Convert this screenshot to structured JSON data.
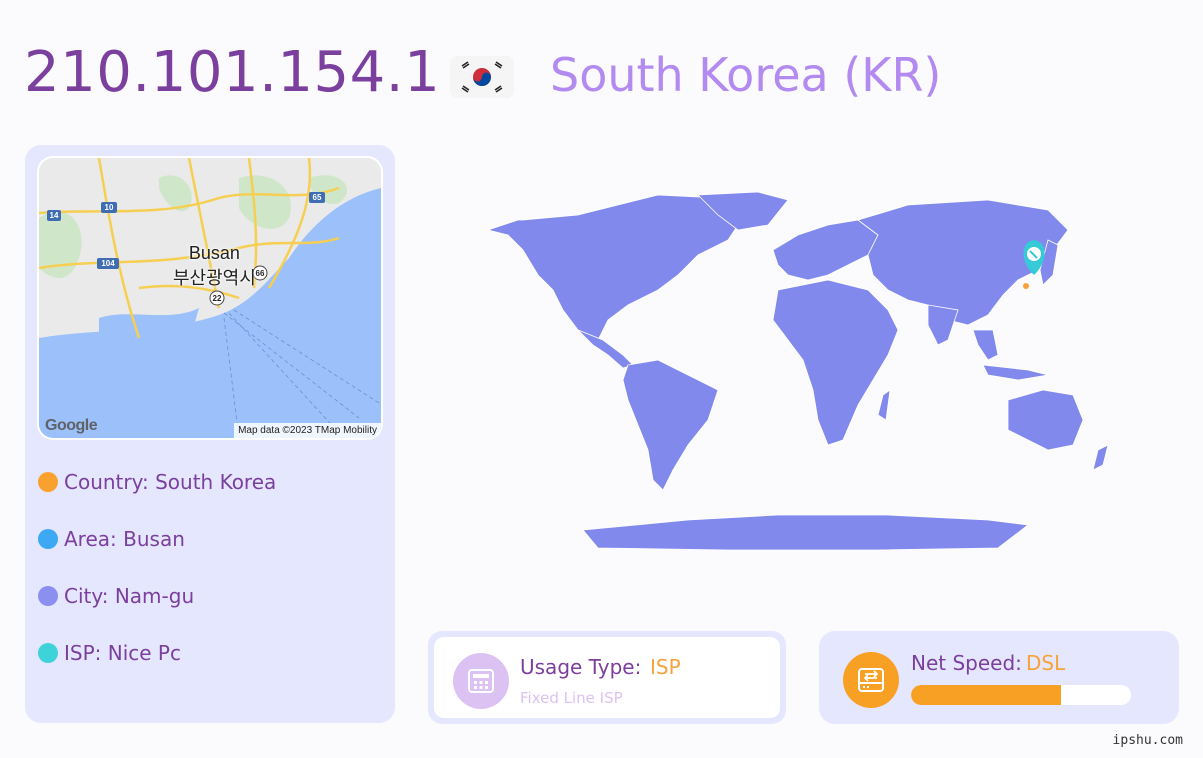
{
  "header": {
    "ip": "210.101.154.1",
    "country_title": "South Korea (KR)",
    "flag_icon": "south-korea-flag"
  },
  "mini_map": {
    "city_en": "Busan",
    "city_ko": "부산광역시",
    "attribution": "Map data ©2023 TMap Mobility",
    "logo_text": "Google",
    "road_labels": [
      "14",
      "10",
      "65",
      "104",
      "66",
      "22"
    ]
  },
  "info": {
    "country": "Country: South Korea",
    "area": "Area: Busan",
    "city": "City: Nam-gu",
    "isp": "ISP: Nice Pc",
    "colors": {
      "country": "#f9a12f",
      "area": "#3da8f4",
      "city": "#8a8ff0",
      "isp": "#3dd3d8"
    }
  },
  "usage": {
    "label": "Usage Type:",
    "value": "ISP",
    "sub": "Fixed Line ISP",
    "icon": "phone-fax-icon"
  },
  "speed": {
    "label": "Net Speed:",
    "value": "DSL",
    "progress": 0.68,
    "icon": "network-drive-icon"
  },
  "watermark": "ipshu.com",
  "colors": {
    "accent_purple": "#7b3f9e",
    "light_purple": "#b38af0",
    "orange": "#f7a23b",
    "map_fill": "#8289ed",
    "marker": "#36c9d6"
  }
}
